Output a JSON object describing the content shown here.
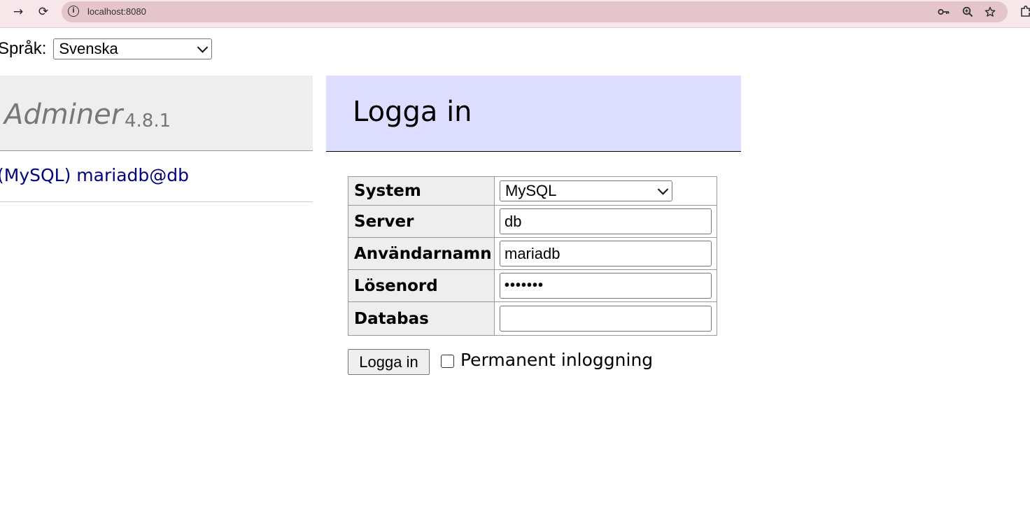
{
  "browser": {
    "url": "localhost:8080",
    "icons": {
      "forward": "arrow-right-icon",
      "reload": "reload-icon",
      "site_info": "info-icon",
      "key": "key-icon",
      "zoom": "zoom-icon",
      "star": "star-icon",
      "extension": "extension-icon"
    }
  },
  "language": {
    "label": "Språk:",
    "selected": "Svenska"
  },
  "menu": {
    "app_name": "Adminer",
    "version": "4.8.1",
    "server_link": "(MySQL) mariadb@db"
  },
  "content": {
    "title": "Logga in"
  },
  "login": {
    "system": {
      "label": "System",
      "selected": "MySQL"
    },
    "server": {
      "label": "Server",
      "value": "db"
    },
    "username": {
      "label": "Användarnamn",
      "value": "mariadb"
    },
    "password": {
      "label": "Lösenord",
      "value": "•••••••"
    },
    "database": {
      "label": "Databas",
      "value": ""
    },
    "submit_label": "Logga in",
    "permanent_label": "Permanent inloggning",
    "permanent_checked": false
  },
  "colors": {
    "menu_bg": "#eeeeee",
    "header_bg": "#ddddff",
    "link": "#000080",
    "browser_bar": "#f7e6ea",
    "omnibox": "#e3c5cb"
  }
}
